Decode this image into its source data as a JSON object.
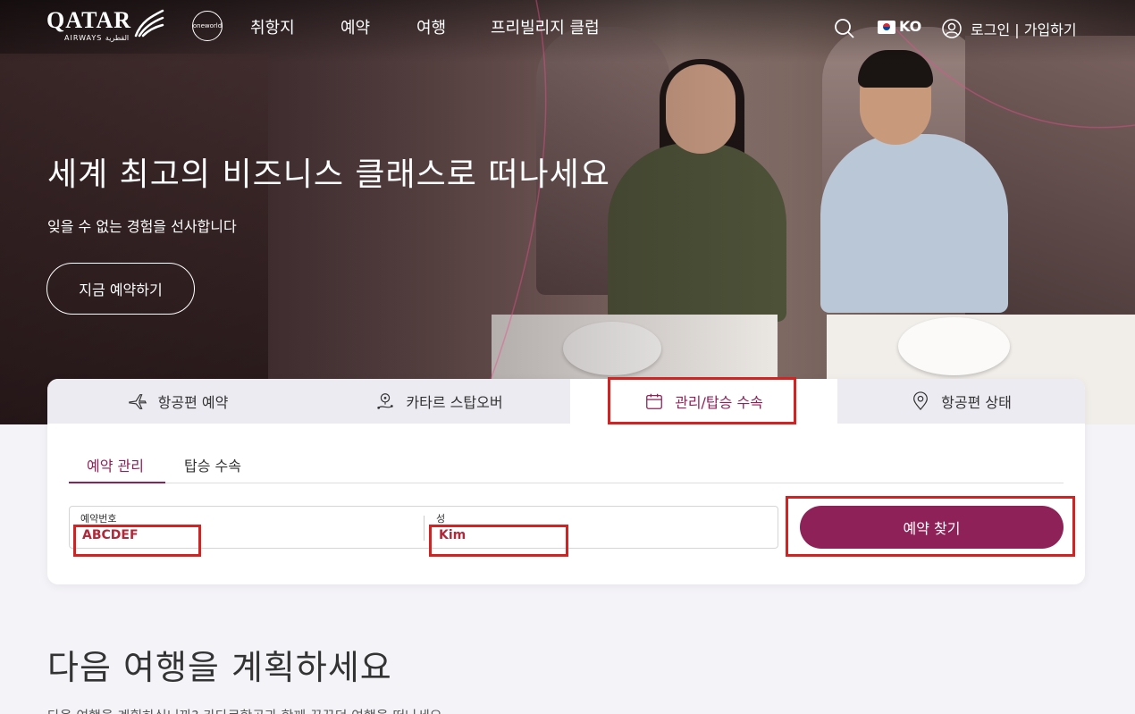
{
  "brand": {
    "logo": "QATAR",
    "logo_sub": "AIRWAYS القطرية",
    "alliance": "oneworld",
    "accent": "#8e2157"
  },
  "nav": {
    "items": [
      "취항지",
      "예약",
      "여행",
      "프리빌리지 클럽"
    ],
    "lang": "KO",
    "login": "로그인 | 가입하기"
  },
  "hero": {
    "title": "세계 최고의 비즈니스 클래스로 떠나세요",
    "subtitle": "잊을 수 없는 경험을 선사합니다",
    "cta": "지금 예약하기"
  },
  "booking": {
    "tabs": [
      {
        "label": "항공편 예약",
        "icon": "plane-icon"
      },
      {
        "label": "카타르 스탑오버",
        "icon": "stopover-icon"
      },
      {
        "label": "관리/탑승 수속",
        "icon": "calendar-icon",
        "active": true
      },
      {
        "label": "항공편 상태",
        "icon": "location-pin-icon"
      }
    ],
    "subtabs": [
      "예약 관리",
      "탑승 수속"
    ],
    "booking_ref_label": "예약번호",
    "booking_ref_value": "ABCDEF",
    "last_name_label": "성",
    "last_name_value": "Kim",
    "search_button": "예약 찾기"
  },
  "section": {
    "title": "다음 여행을 계획하세요",
    "body": "다음 여행을 계획하십니까? 카타르항공과 함께 꿈꾸던 여행을 떠나세요."
  }
}
